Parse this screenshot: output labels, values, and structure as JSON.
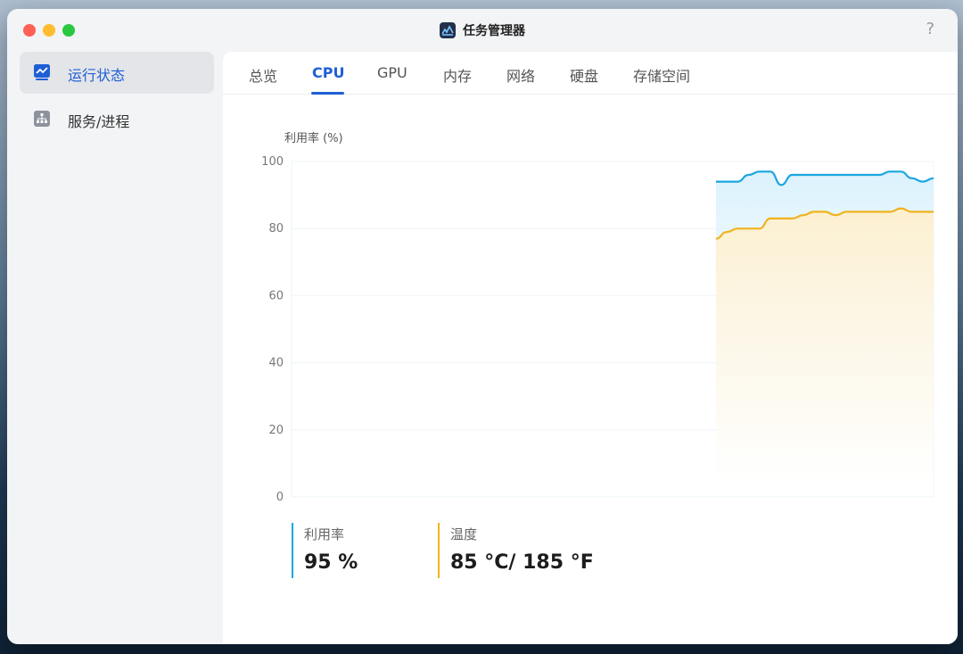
{
  "window": {
    "title": "任务管理器",
    "help_label": "?"
  },
  "sidebar": {
    "items": [
      {
        "label": "运行状态",
        "active": true
      },
      {
        "label": "服务/进程",
        "active": false
      }
    ]
  },
  "tabs": [
    {
      "label": "总览"
    },
    {
      "label": "CPU",
      "active": true
    },
    {
      "label": "GPU"
    },
    {
      "label": "内存"
    },
    {
      "label": "网络"
    },
    {
      "label": "硬盘"
    },
    {
      "label": "存储空间"
    }
  ],
  "colors": {
    "accent": "#1f5fd6",
    "utilization": "#1aa6e0",
    "temperature": "#f0b320"
  },
  "chart_data": {
    "type": "area",
    "ylabel": "利用率 (%)",
    "ylim": [
      0,
      100
    ],
    "yticks": [
      "0",
      "20",
      "40",
      "60",
      "80",
      "100"
    ],
    "grid": true,
    "sample_count": 60,
    "x": [
      39,
      40,
      41,
      42,
      43,
      44,
      45,
      46,
      47,
      48,
      49,
      50,
      51,
      52,
      53,
      54,
      55,
      56,
      57,
      58,
      59
    ],
    "series": [
      {
        "name": "利用率",
        "values": [
          94,
          94,
          94,
          96,
          97,
          97,
          93,
          96,
          96,
          96,
          96,
          96,
          96,
          96,
          96,
          96,
          97,
          97,
          95,
          94,
          95
        ]
      },
      {
        "name": "温度",
        "values": [
          77,
          79,
          80,
          80,
          80,
          83,
          83,
          83,
          84,
          85,
          85,
          84,
          85,
          85,
          85,
          85,
          85,
          86,
          85,
          85,
          85
        ]
      }
    ]
  },
  "legend": {
    "utilization": {
      "label": "利用率",
      "value": "95 %"
    },
    "temperature": {
      "label": "温度",
      "value": "85 °C/ 185 °F"
    }
  }
}
